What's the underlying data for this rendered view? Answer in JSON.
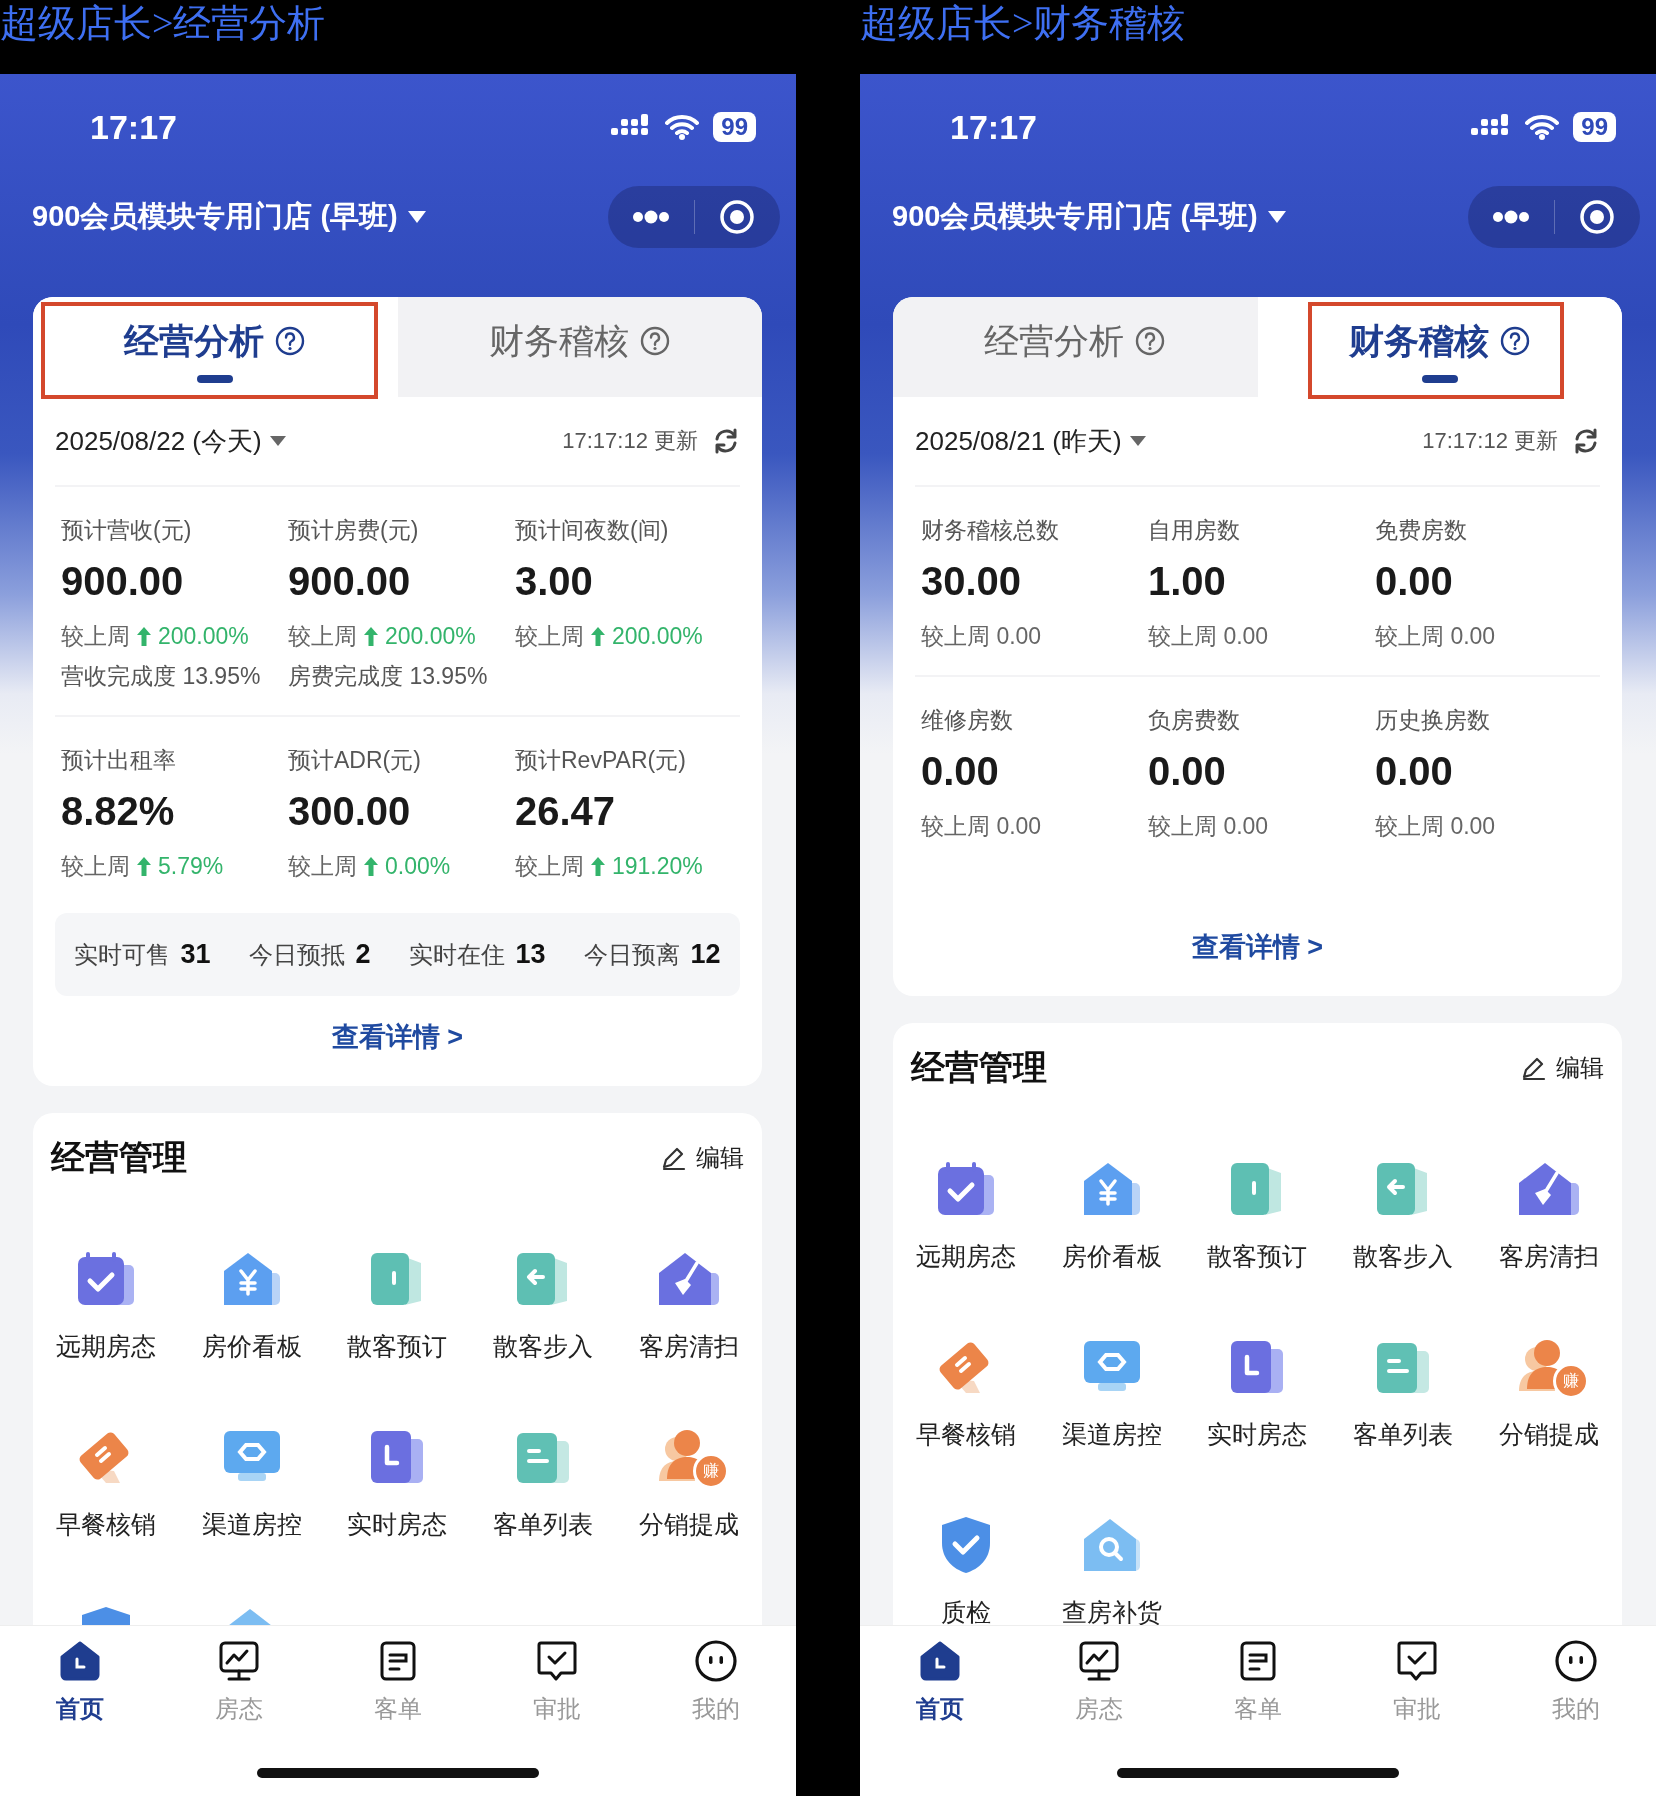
{
  "screens": [
    {
      "caption": "超级店长>经营分析",
      "status_bar": {
        "time": "17:17",
        "battery": "99"
      },
      "store": "900会员模块专用门店 (早班)",
      "tabs": [
        {
          "label": "经营分析",
          "selected": true,
          "highlighted": true
        },
        {
          "label": "财务稽核",
          "selected": false,
          "highlighted": false
        }
      ],
      "date": "2025/08/22 (今天)",
      "updated": "17:17:12 更新",
      "metric_rows": [
        [
          {
            "label": "预计营收(元)",
            "value": "900.00",
            "compare": "较上周",
            "change": "200.00%",
            "rising": true,
            "completion": "营收完成度 13.95%"
          },
          {
            "label": "预计房费(元)",
            "value": "900.00",
            "compare": "较上周",
            "change": "200.00%",
            "rising": true,
            "completion": "房费完成度 13.95%"
          },
          {
            "label": "预计间夜数(间)",
            "value": "3.00",
            "compare": "较上周",
            "change": "200.00%",
            "rising": true
          }
        ],
        [
          {
            "label": "预计出租率",
            "value": "8.82%",
            "compare": "较上周",
            "change": "5.79%",
            "rising": true
          },
          {
            "label": "预计ADR(元)",
            "value": "300.00",
            "compare": "较上周",
            "change": "0.00%",
            "rising": true
          },
          {
            "label": "预计RevPAR(元)",
            "value": "26.47",
            "compare": "较上周",
            "change": "191.20%",
            "rising": true
          }
        ]
      ],
      "stats": [
        {
          "label": "实时可售",
          "value": "31"
        },
        {
          "label": "今日预抵",
          "value": "2"
        },
        {
          "label": "实时在住",
          "value": "13"
        },
        {
          "label": "今日预离",
          "value": "12"
        }
      ],
      "details_link": "查看详情 >",
      "management": {
        "title": "经营管理",
        "edit": "编辑",
        "items": [
          {
            "label": "远期房态",
            "kind": "calendar"
          },
          {
            "label": "房价看板",
            "kind": "yen-house"
          },
          {
            "label": "散客预订",
            "kind": "door"
          },
          {
            "label": "散客步入",
            "kind": "door-arrow"
          },
          {
            "label": "客房清扫",
            "kind": "broom-house"
          },
          {
            "label": "早餐核销",
            "kind": "ticket"
          },
          {
            "label": "渠道房控",
            "kind": "monitor"
          },
          {
            "label": "实时房态",
            "kind": "doc-l"
          },
          {
            "label": "客单列表",
            "kind": "doc-lines"
          },
          {
            "label": "分销提成",
            "kind": "person-badge",
            "badge": "赚"
          },
          {
            "kind": "shield-check"
          },
          {
            "kind": "search-house"
          }
        ]
      },
      "nav": [
        {
          "label": "首页",
          "kind": "home",
          "selected": true
        },
        {
          "label": "房态",
          "kind": "monitor-chart",
          "selected": false
        },
        {
          "label": "客单",
          "kind": "document",
          "selected": false
        },
        {
          "label": "审批",
          "kind": "chat-check",
          "selected": false
        },
        {
          "label": "我的",
          "kind": "smiley",
          "selected": false
        }
      ]
    },
    {
      "caption": "超级店长>财务稽核",
      "status_bar": {
        "time": "17:17",
        "battery": "99"
      },
      "store": "900会员模块专用门店 (早班)",
      "tabs": [
        {
          "label": "经营分析",
          "selected": false,
          "highlighted": false
        },
        {
          "label": "财务稽核",
          "selected": true,
          "highlighted": true
        }
      ],
      "date": "2025/08/21 (昨天)",
      "updated": "17:17:12 更新",
      "metric_rows": [
        [
          {
            "label": "财务稽核总数",
            "value": "30.00",
            "compare": "较上周 0.00"
          },
          {
            "label": "自用房数",
            "value": "1.00",
            "compare": "较上周 0.00"
          },
          {
            "label": "免费房数",
            "value": "0.00",
            "compare": "较上周 0.00"
          }
        ],
        [
          {
            "label": "维修房数",
            "value": "0.00",
            "compare": "较上周 0.00"
          },
          {
            "label": "负房费数",
            "value": "0.00",
            "compare": "较上周 0.00"
          },
          {
            "label": "历史换房数",
            "value": "0.00",
            "compare": "较上周 0.00"
          }
        ]
      ],
      "details_link": "查看详情 >",
      "management": {
        "title": "经营管理",
        "edit": "编辑",
        "items": [
          {
            "label": "远期房态",
            "kind": "calendar"
          },
          {
            "label": "房价看板",
            "kind": "yen-house"
          },
          {
            "label": "散客预订",
            "kind": "door"
          },
          {
            "label": "散客步入",
            "kind": "door-arrow"
          },
          {
            "label": "客房清扫",
            "kind": "broom-house"
          },
          {
            "label": "早餐核销",
            "kind": "ticket"
          },
          {
            "label": "渠道房控",
            "kind": "monitor"
          },
          {
            "label": "实时房态",
            "kind": "doc-l"
          },
          {
            "label": "客单列表",
            "kind": "doc-lines"
          },
          {
            "label": "分销提成",
            "kind": "person-badge",
            "badge": "赚"
          },
          {
            "label": "质检",
            "kind": "shield-check"
          },
          {
            "label": "查房补货",
            "kind": "search-house"
          }
        ]
      },
      "nav": [
        {
          "label": "首页",
          "kind": "home",
          "selected": true
        },
        {
          "label": "房态",
          "kind": "monitor-chart",
          "selected": false
        },
        {
          "label": "客单",
          "kind": "document",
          "selected": false
        },
        {
          "label": "审批",
          "kind": "chat-check",
          "selected": false
        },
        {
          "label": "我的",
          "kind": "smiley",
          "selected": false
        }
      ]
    }
  ]
}
